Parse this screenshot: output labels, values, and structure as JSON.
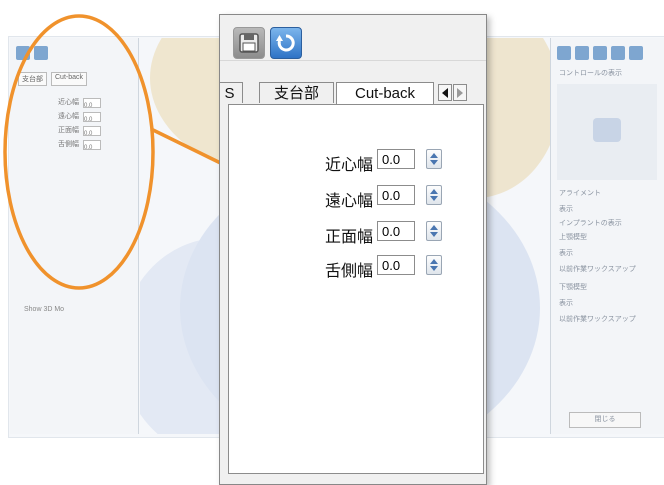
{
  "toolbar": {
    "save_icon": "save-icon",
    "refresh_icon": "refresh-icon"
  },
  "tabs": {
    "partial": "S",
    "abutment": "支台部",
    "cutback": "Cut-back",
    "active": "Cut-back"
  },
  "fields": [
    {
      "label": "近心幅",
      "value": "0.0"
    },
    {
      "label": "遠心幅",
      "value": "0.0"
    },
    {
      "label": "正面幅",
      "value": "0.0"
    },
    {
      "label": "舌側幅",
      "value": "0.0"
    }
  ],
  "background": {
    "left_panel": {
      "tab_abutment": "支台部",
      "tab_cutback": "Cut-back",
      "rows": [
        {
          "label": "近心幅",
          "value": "0.0"
        },
        {
          "label": "遠心幅",
          "value": "0.0"
        },
        {
          "label": "正面幅",
          "value": "0.0"
        },
        {
          "label": "舌側幅",
          "value": "0.0"
        }
      ],
      "show_3d": "Show 3D Mo"
    },
    "right_panel": {
      "control_title": "コントロールの表示",
      "alignment": "アライメント",
      "show": "表示",
      "implant_show": "インプラントの表示",
      "upper_model": "上顎模型",
      "show_upper": "表示",
      "wax_up_upper": "以前作業ワックスアップ",
      "lower_model": "下顎模型",
      "show_lower": "表示",
      "wax_up_lower": "以前作業ワックスアップ",
      "bottom_button": "閉じる"
    }
  },
  "colors": {
    "callout": "#f0922c",
    "refresh_blue": "#2e73c6"
  }
}
